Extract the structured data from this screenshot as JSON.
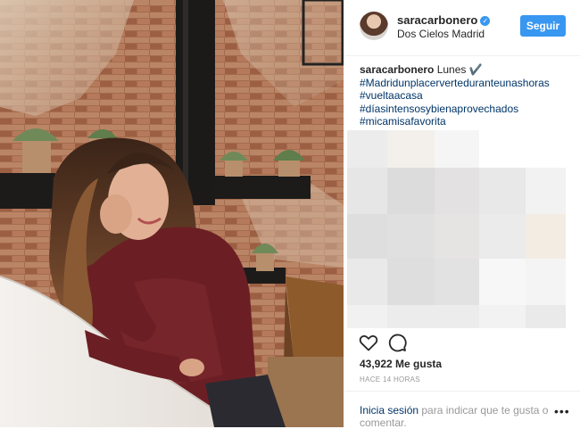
{
  "post": {
    "username": "saracarbonero",
    "verified_icon": "verified-badge-icon",
    "location": "Dos Cielos Madrid",
    "follow_label": "Seguir"
  },
  "caption": {
    "username": "saracarbonero",
    "text": " Lunes ✔️",
    "hashtags": [
      "#Madridunplacerverteduranteunashoras",
      "#vueltaacasa",
      "#díasintensosybienaprovechados",
      "#micamisafavorita"
    ]
  },
  "actions": {
    "like_icon": "heart-icon",
    "comment_icon": "comment-icon"
  },
  "likes": "43,922 Me gusta",
  "timestamp": "HACE 14 HORAS",
  "footer": {
    "login_link": "Inicia sesión",
    "login_text": " para indicar que te gusta o comentar.",
    "more_icon": "more-options-icon"
  },
  "colors": {
    "accent": "#3897f0",
    "link": "#003569",
    "muted": "#999999"
  }
}
